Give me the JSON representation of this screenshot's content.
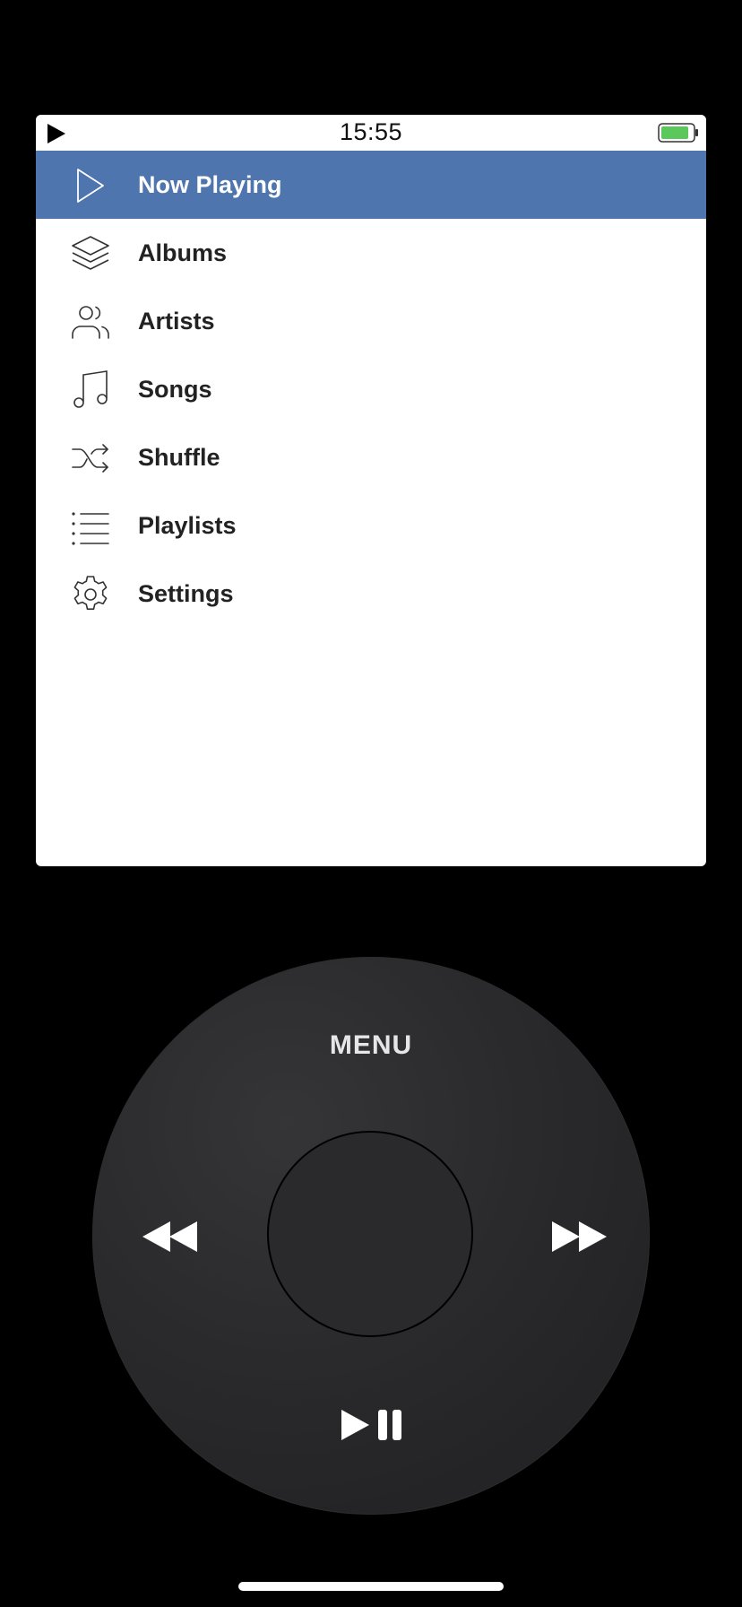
{
  "status_bar": {
    "time": "15:55",
    "play_icon": "play-icon",
    "battery_icon": "battery-icon",
    "battery_color": "#5ac85a"
  },
  "menu": {
    "accent_color": "#4e75ad",
    "items": [
      {
        "label": "Now Playing",
        "icon": "play-outline-icon",
        "selected": true
      },
      {
        "label": "Albums",
        "icon": "layers-icon",
        "selected": false
      },
      {
        "label": "Artists",
        "icon": "users-icon",
        "selected": false
      },
      {
        "label": "Songs",
        "icon": "music-note-icon",
        "selected": false
      },
      {
        "label": "Shuffle",
        "icon": "shuffle-icon",
        "selected": false
      },
      {
        "label": "Playlists",
        "icon": "list-icon",
        "selected": false
      },
      {
        "label": "Settings",
        "icon": "gear-icon",
        "selected": false
      }
    ]
  },
  "wheel": {
    "menu_label": "MENU",
    "rewind_icon": "rewind-icon",
    "fast_forward_icon": "fast-forward-icon",
    "play_pause_icon": "play-pause-icon"
  }
}
